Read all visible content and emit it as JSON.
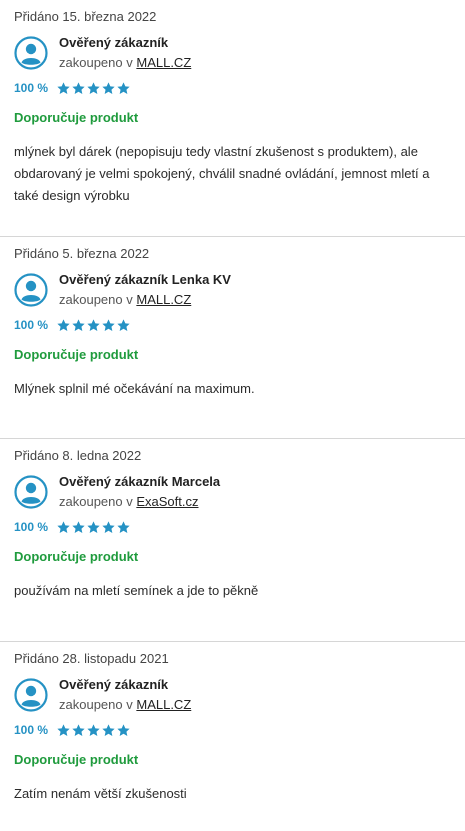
{
  "colors": {
    "accent_blue": "#2592c4",
    "recommend_green": "#1f9b3d",
    "divider": "#d6d6d6"
  },
  "icons": {
    "avatar": "user-avatar-icon",
    "star": "star-icon"
  },
  "reviews": [
    {
      "added": "Přidáno 15. března 2022",
      "author": "Ověřený zákazník",
      "purchased_prefix": "zakoupeno v",
      "shop": "MALL.CZ",
      "rating": "100 %",
      "stars": 5,
      "recommend": "Doporučuje produkt",
      "text": "mlýnek byl dárek (nepopisuju tedy vlastní zkušenost s produktem), ale obdarovaný je velmi spokojený, chválil snadné ovládání, jemnost mletí a také design výrobku"
    },
    {
      "added": "Přidáno 5. března 2022",
      "author": "Ověřený zákazník Lenka KV",
      "purchased_prefix": "zakoupeno v",
      "shop": "MALL.CZ",
      "rating": "100 %",
      "stars": 5,
      "recommend": "Doporučuje produkt",
      "text": "Mlýnek splnil mé očekávání na maximum."
    },
    {
      "added": "Přidáno 8. ledna 2022",
      "author": "Ověřený zákazník Marcela",
      "purchased_prefix": "zakoupeno v",
      "shop": "ExaSoft.cz",
      "rating": "100 %",
      "stars": 5,
      "recommend": "Doporučuje produkt",
      "text": "používám na mletí semínek a jde to pěkně"
    },
    {
      "added": "Přidáno 28. listopadu 2021",
      "author": "Ověřený zákazník",
      "purchased_prefix": "zakoupeno v",
      "shop": "MALL.CZ",
      "rating": "100 %",
      "stars": 5,
      "recommend": "Doporučuje produkt",
      "text": "Zatím nenám větší zkušenosti"
    }
  ]
}
